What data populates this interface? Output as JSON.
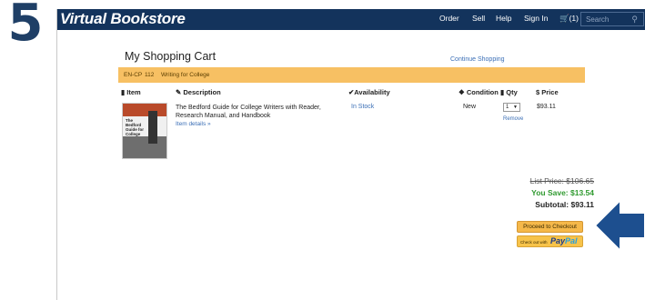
{
  "step_number": "5",
  "navbar": {
    "brand": "Virtual Bookstore",
    "links": [
      "Order",
      "Sell",
      "Help",
      "Sign In"
    ],
    "cart_label": "(1)",
    "search_placeholder": "Search"
  },
  "page": {
    "title": "My Shopping Cart",
    "continue_link": "Continue Shopping"
  },
  "course": {
    "code": "EN-CP",
    "number": "112",
    "name": "Writing for College"
  },
  "table": {
    "headers": {
      "item": "Item",
      "description": "Description",
      "availability": "Availability",
      "condition": "Condition",
      "qty": "Qty",
      "price": "Price"
    }
  },
  "cart_item": {
    "cover_text": "The Bedford Guide for College Writers",
    "description": "The Bedford Guide for College Writers with Reader, Research Manual, and Handbook",
    "details_link": "Item details »",
    "availability": "In Stock",
    "condition": "New",
    "qty": "1",
    "remove_link": "Remove",
    "price": "$93.11"
  },
  "summary": {
    "list_price": "List Price: $106.65",
    "you_save": "You Save: $13.54",
    "subtotal": "Subtotal: $93.11"
  },
  "buttons": {
    "checkout": "Proceed to Checkout",
    "paypal_prefix": "Check out with",
    "paypal_pay": "Pay",
    "paypal_pal": "Pal"
  },
  "colors": {
    "navbar": "#13335c",
    "course_bar": "#f7c063",
    "link": "#3b6fb6",
    "save_green": "#2f9a2f",
    "arrow_blue": "#1d4f8f"
  }
}
